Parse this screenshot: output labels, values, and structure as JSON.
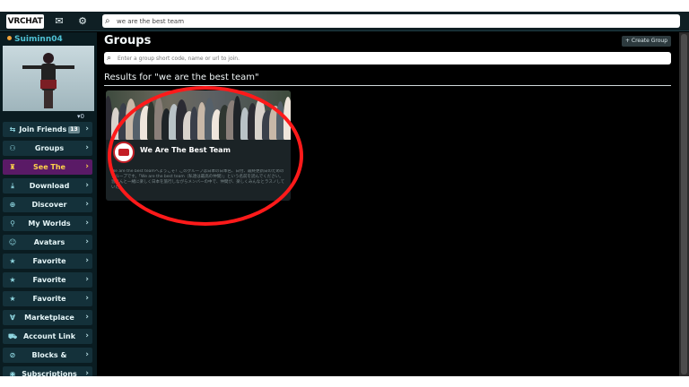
{
  "topbar": {
    "logo": "VRCHAT",
    "search_value": "we are the best team"
  },
  "sidebar": {
    "username": "Suiminn04",
    "avatar_count": "▾0",
    "items": [
      {
        "label": "Join Friends",
        "icon": "⇆",
        "badge": "13"
      },
      {
        "label": "Groups",
        "icon": "⚇"
      },
      {
        "label": "See The Winners",
        "icon": "♜"
      },
      {
        "label": "Download",
        "icon": "⤓"
      },
      {
        "label": "Discover Worlds",
        "icon": "⊕"
      },
      {
        "label": "My Worlds",
        "icon": "⚲"
      },
      {
        "label": "Avatars",
        "icon": "☺"
      },
      {
        "label": "Favorite Worlds",
        "icon": "★"
      },
      {
        "label": "Favorite Avatars",
        "icon": "★"
      },
      {
        "label": "Favorite Friends",
        "icon": "★"
      },
      {
        "label": "Marketplace",
        "icon": "∀"
      },
      {
        "label": "Account Link",
        "icon": "⛟"
      },
      {
        "label": "Blocks & Mutes",
        "icon": "⊘"
      },
      {
        "label": "Subscriptions",
        "icon": "◉"
      }
    ]
  },
  "main": {
    "title": "Groups",
    "create_button": "+ Create Group",
    "search_placeholder": "Enter a group short code, name or url to join.",
    "results_heading": "Results for \"we are the best team\""
  },
  "group_card": {
    "name": "We Are The Best Team",
    "description": "We are the best teamへようこそ！このグループは日本の日本名、日付、最終更新日のためのグループです。「We are the best team（私達は最高の仲間）」という名前を読んでください。皆さんと一緒に楽しく日本を旅行しながらメンバーの中で、仲間が、楽しくみんなとラスノしていた"
  },
  "colors": {
    "accent": "#4fc1d4",
    "highlight_nav": "#5a1a66",
    "highlight_text": "#ffd34a",
    "annotation": "#ff1a1a"
  }
}
